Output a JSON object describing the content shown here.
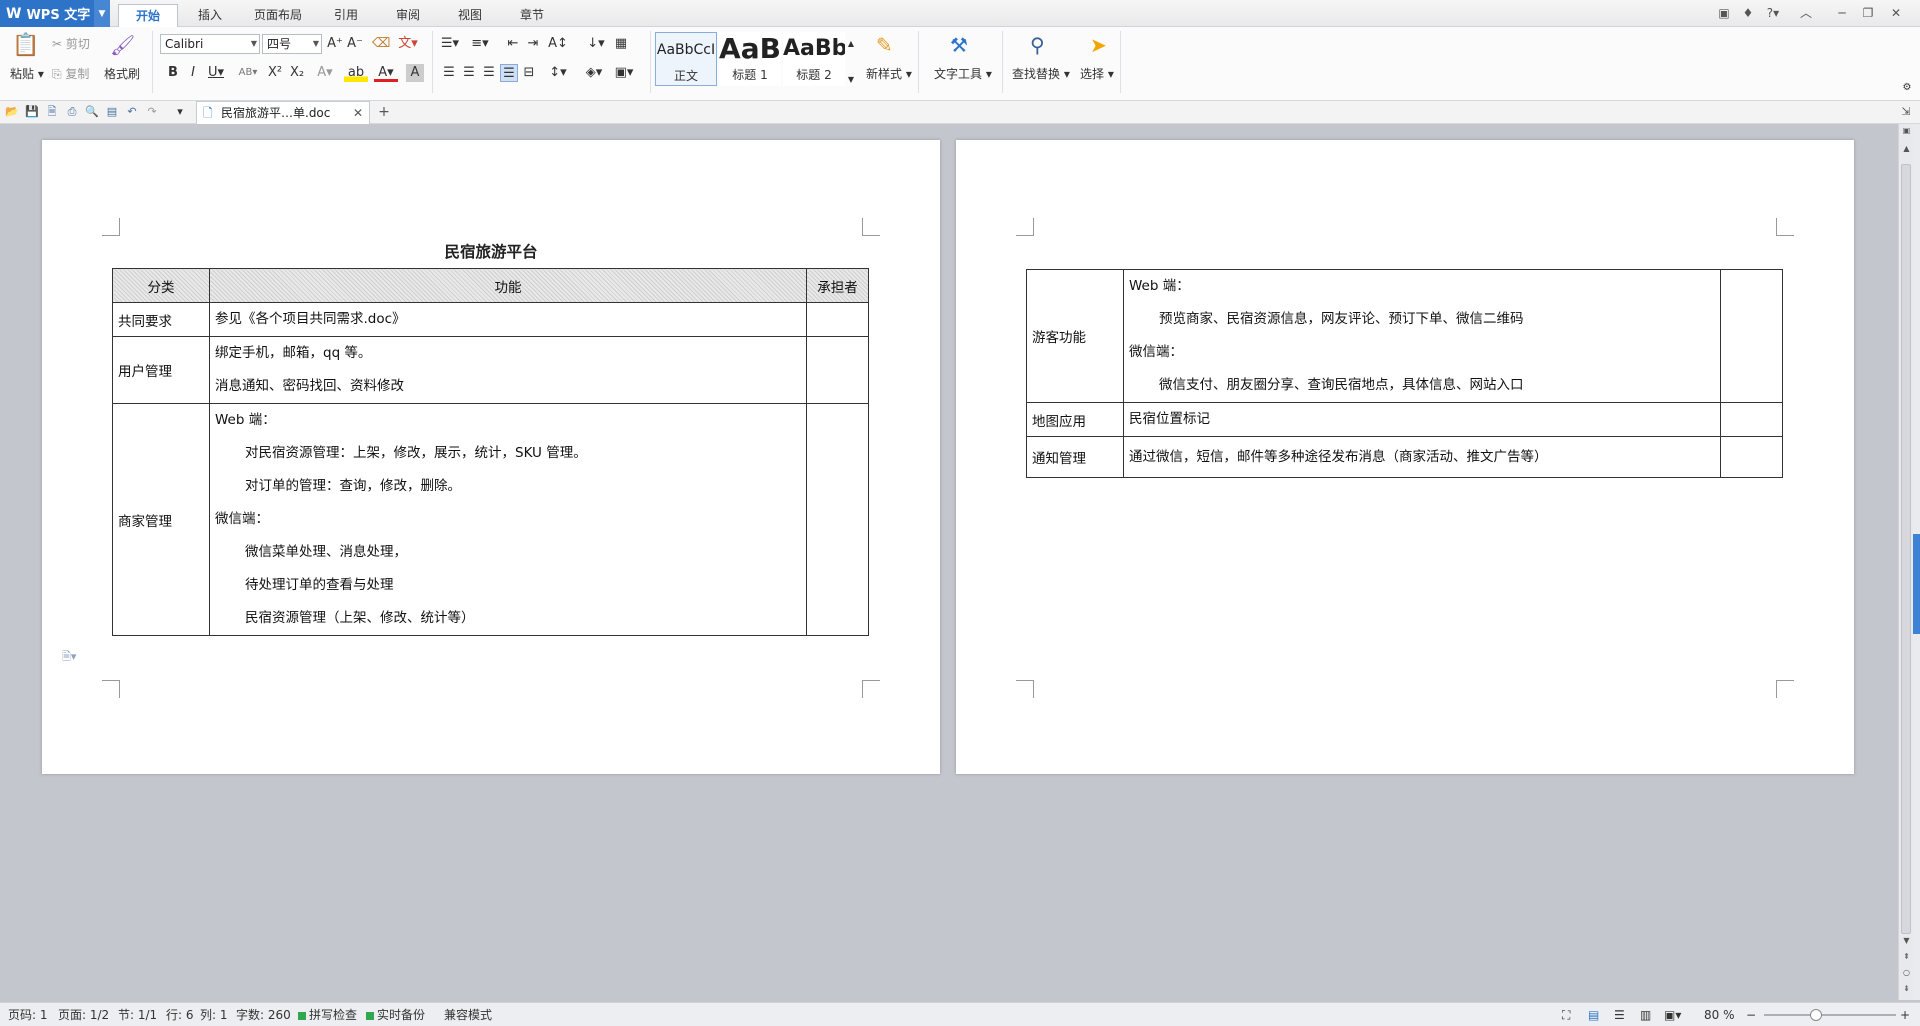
{
  "app": {
    "name": "WPS 文字"
  },
  "ribbon_tabs": [
    "开始",
    "插入",
    "页面布局",
    "引用",
    "审阅",
    "视图",
    "章节"
  ],
  "active_tab": "开始",
  "clipboard": {
    "paste": "粘贴",
    "cut": "剪切",
    "copy": "复制",
    "format_painter": "格式刷"
  },
  "font": {
    "family": "Calibri",
    "size": "四号"
  },
  "styles": [
    {
      "preview": "AaBbCcI",
      "label": "正文"
    },
    {
      "preview": "AaB",
      "label": "标题 1"
    },
    {
      "preview": "AaBb",
      "label": "标题 2"
    }
  ],
  "tools": {
    "new_style": "新样式",
    "text_tools": "文字工具",
    "find_replace": "查找替换",
    "select": "选择"
  },
  "document_tab": {
    "title": "民宿旅游平…单.doc"
  },
  "document": {
    "title": "民宿旅游平台",
    "headers": [
      "分类",
      "功能",
      "承担者"
    ],
    "page1_rows": [
      {
        "category": "共同要求",
        "lines": [
          {
            "text": "参见《各个项目共同需求.doc》",
            "indent": false
          }
        ]
      },
      {
        "category": "用户管理",
        "lines": [
          {
            "text": "绑定手机，邮箱，qq 等。",
            "indent": false
          },
          {
            "text": "消息通知、密码找回、资料修改",
            "indent": false
          }
        ]
      },
      {
        "category": "商家管理",
        "lines": [
          {
            "text": "Web 端：",
            "indent": false
          },
          {
            "text": "对民宿资源管理：上架，修改，展示，统计，SKU 管理。",
            "indent": true
          },
          {
            "text": "对订单的管理：查询，修改，删除。",
            "indent": true
          },
          {
            "text": "微信端：",
            "indent": false
          },
          {
            "text": "微信菜单处理、消息处理，",
            "indent": true
          },
          {
            "text": "待处理订单的查看与处理",
            "indent": true
          },
          {
            "text": "民宿资源管理（上架、修改、统计等）",
            "indent": true
          }
        ]
      }
    ],
    "page2_rows": [
      {
        "category": "游客功能",
        "lines": [
          {
            "text": "Web 端：",
            "indent": false
          },
          {
            "text": "预览商家、民宿资源信息，网友评论、预订下单、微信二维码",
            "indent": true
          },
          {
            "text": "微信端：",
            "indent": false
          },
          {
            "text": "微信支付、朋友圈分享、查询民宿地点，具体信息、网站入口",
            "indent": true
          }
        ]
      },
      {
        "category": "地图应用",
        "lines": [
          {
            "text": "民宿位置标记",
            "indent": false
          }
        ]
      },
      {
        "category": "通知管理",
        "lines": [
          {
            "text": "通过微信，短信，邮件等多种途径发布消息（商家活动、推文广告等）",
            "indent": false
          }
        ]
      }
    ]
  },
  "status_bar": {
    "page_no": "页码: 1",
    "pages": "页面: 1/2",
    "section": "节: 1/1",
    "row": "行: 6",
    "col": "列: 1",
    "word_count": "字数: 260",
    "spell_check": "拼写检查",
    "backup": "实时备份",
    "compat": "兼容模式",
    "zoom": "80 %"
  },
  "colors": {
    "accent": "#2d74c9",
    "workspace": "#c3c6cd",
    "status_ok": "#2fa84f"
  }
}
